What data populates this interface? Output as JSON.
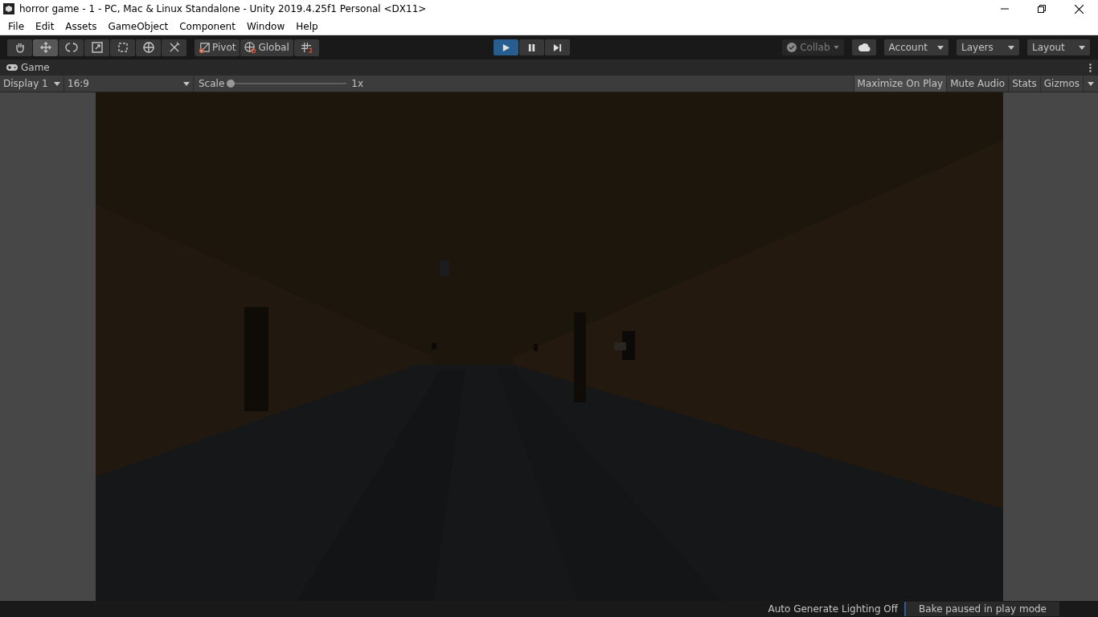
{
  "window": {
    "title": "horror game - 1 - PC, Mac & Linux Standalone - Unity 2019.4.25f1 Personal <DX11>"
  },
  "menu": [
    "File",
    "Edit",
    "Assets",
    "GameObject",
    "Component",
    "Window",
    "Help"
  ],
  "tools": [
    {
      "kind": "hand",
      "selected": false
    },
    {
      "kind": "move",
      "selected": true
    },
    {
      "kind": "rotate",
      "selected": false
    },
    {
      "kind": "scale",
      "selected": false
    },
    {
      "kind": "rect",
      "selected": false
    },
    {
      "kind": "transform",
      "selected": false
    },
    {
      "kind": "custom",
      "selected": false
    }
  ],
  "handle_toggles": [
    {
      "kind": "pivot",
      "label": "Pivot"
    },
    {
      "kind": "global",
      "label": "Global"
    }
  ],
  "playback": [
    {
      "kind": "play",
      "selected": true
    },
    {
      "kind": "pause",
      "selected": false
    },
    {
      "kind": "step",
      "selected": false
    }
  ],
  "collab": {
    "label": "Collab",
    "disabled": true
  },
  "account_menus": [
    "Account",
    "Layers",
    "Layout"
  ],
  "game_tab": {
    "label": "Game"
  },
  "game_toolbar": {
    "display": "Display 1",
    "aspect": "16:9",
    "scale_label": "Scale",
    "scale": {
      "level": 0.0,
      "reading": "1x"
    },
    "toggles": [
      {
        "label": "Maximize On Play",
        "selected": true
      },
      {
        "label": "Mute Audio",
        "selected": false
      },
      {
        "label": "Stats",
        "selected": false
      },
      {
        "label": "Gizmos",
        "selected": false
      }
    ]
  },
  "game_view": {
    "kind": "picture"
  },
  "status_bar": {
    "lighting": "Auto Generate Lighting Off",
    "bake": "Bake paused in play mode"
  }
}
